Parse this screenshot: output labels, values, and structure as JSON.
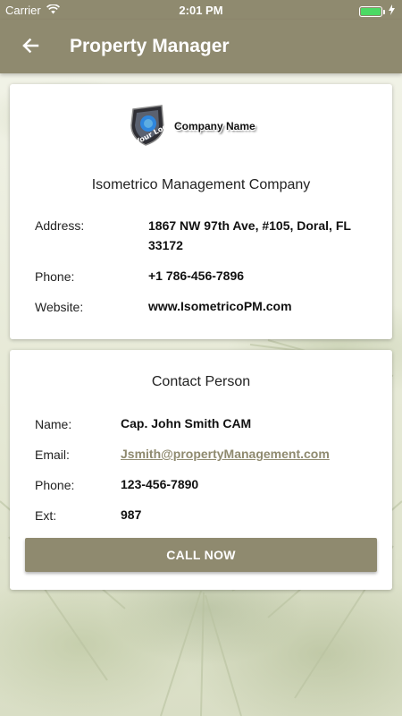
{
  "status_bar": {
    "carrier": "Carrier",
    "time": "2:01 PM",
    "icons": [
      "wifi-icon",
      "battery-icon",
      "charging-bolt-icon"
    ],
    "battery_level": 1.0,
    "battery_color": "#4cd964"
  },
  "app_bar": {
    "title": "Property Manager",
    "back_icon": "arrow-left-icon",
    "color": "#8f8a6f"
  },
  "company": {
    "logo_badge_text": "Your Logo",
    "logo_text": "Company Name",
    "name": "Isometrico Management Company",
    "fields": [
      {
        "label": "Address:",
        "value": "1867 NW 97th Ave, #105, Doral, FL 33172"
      },
      {
        "label": "Phone:",
        "value": "+1 786-456-7896"
      },
      {
        "label": "Website:",
        "value": "www.IsometricoPM.com"
      }
    ]
  },
  "contact": {
    "title": "Contact Person",
    "fields": [
      {
        "label": "Name:",
        "value": "Cap. John Smith CAM"
      },
      {
        "label": "Email:",
        "value": "Jsmith@propertyManagement.com"
      },
      {
        "label": "Phone:",
        "value": "123-456-7890"
      },
      {
        "label": "Ext:",
        "value": "987"
      }
    ],
    "call_button_label": "CALL NOW"
  }
}
